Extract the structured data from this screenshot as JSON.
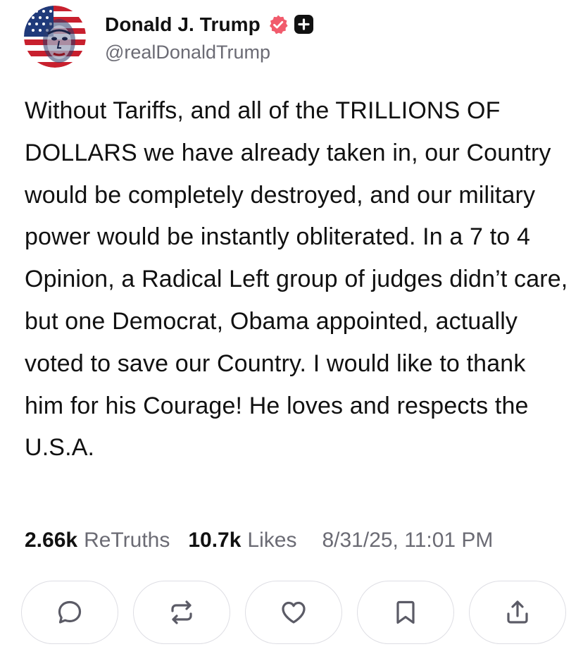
{
  "author": {
    "display_name": "Donald J. Trump",
    "handle": "@realDonaldTrump",
    "verified": true,
    "avatar_icon": "avatar-flag-portrait"
  },
  "post": {
    "text": "Without Tariffs, and all of the TRILLIONS OF DOLLARS we have already taken in, our Country would be completely destroyed, and our military power would be instantly obliterated. In a 7 to 4 Opinion, a Radical Left group of judges didn’t care, but one Democrat, Obama appointed, actually voted to save our Country. I would like to thank him for his Courage! He loves and respects the U.S.A."
  },
  "stats": {
    "retruths_count": "2.66k",
    "retruths_label": "ReTruths",
    "likes_count": "10.7k",
    "likes_label": "Likes",
    "timestamp": "8/31/25, 11:01 PM"
  },
  "actions": [
    {
      "name": "reply",
      "icon": "comment-icon"
    },
    {
      "name": "retruth",
      "icon": "repost-icon"
    },
    {
      "name": "like",
      "icon": "heart-icon"
    },
    {
      "name": "bookmark",
      "icon": "bookmark-icon"
    },
    {
      "name": "share",
      "icon": "share-icon"
    }
  ],
  "colors": {
    "verified_badge": "#f15b6c",
    "muted_text": "#6b6b74",
    "icon_stroke": "#5b5b66",
    "button_border": "#dedee4"
  }
}
